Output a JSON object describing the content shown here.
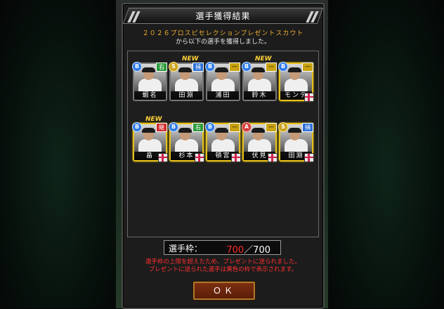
{
  "dialog": {
    "title": "選手獲得結果",
    "notice_line1": "２０２６プロスピセレクションプレゼントスカウト",
    "notice_line2": "から以下の選手を獲得しました。"
  },
  "players_row1": [
    {
      "name": "蝦名",
      "rank": "B",
      "position": "右",
      "pos_color": "green",
      "is_new": false,
      "gift": false
    },
    {
      "name": "田淵",
      "rank": "S",
      "position": "捕",
      "pos_color": "blue",
      "is_new": true,
      "gift": false
    },
    {
      "name": "浦田",
      "rank": "B",
      "position": "一",
      "pos_color": "yellow",
      "is_new": false,
      "gift": false
    },
    {
      "name": "鈴木",
      "rank": "B",
      "position": "一",
      "pos_color": "yellow",
      "is_new": true,
      "gift": false
    },
    {
      "name": "モンテ",
      "rank": "B",
      "position": "一",
      "pos_color": "yellow",
      "is_new": false,
      "gift": true
    }
  ],
  "players_row2": [
    {
      "name": "畠",
      "rank": "B",
      "position": "継",
      "pos_color": "red",
      "is_new": true,
      "gift": true
    },
    {
      "name": "杉本",
      "rank": "B",
      "position": "右",
      "pos_color": "green",
      "is_new": false,
      "gift": true
    },
    {
      "name": "頓宮",
      "rank": "B",
      "position": "一",
      "pos_color": "yellow",
      "is_new": false,
      "gift": true
    },
    {
      "name": "伏見",
      "rank": "A",
      "position": "一",
      "pos_color": "yellow",
      "is_new": false,
      "gift": true
    },
    {
      "name": "田淵",
      "rank": "S",
      "position": "捕",
      "pos_color": "blue",
      "is_new": false,
      "gift": true
    }
  ],
  "new_badge": "NEW",
  "roster": {
    "label": "選手枠：",
    "current": "700",
    "separator": "／",
    "max": "700"
  },
  "warning_line1": "選手枠の上限を超えたため、プレゼントに送られました。",
  "warning_line2": "プレゼントに送られた選手は黄色の枠で表示されます。",
  "ok_label": "ＯＫ",
  "colors": {
    "gift_frame": "#e7c11a",
    "warning": "#ff3030",
    "notice": "#f0b030"
  }
}
